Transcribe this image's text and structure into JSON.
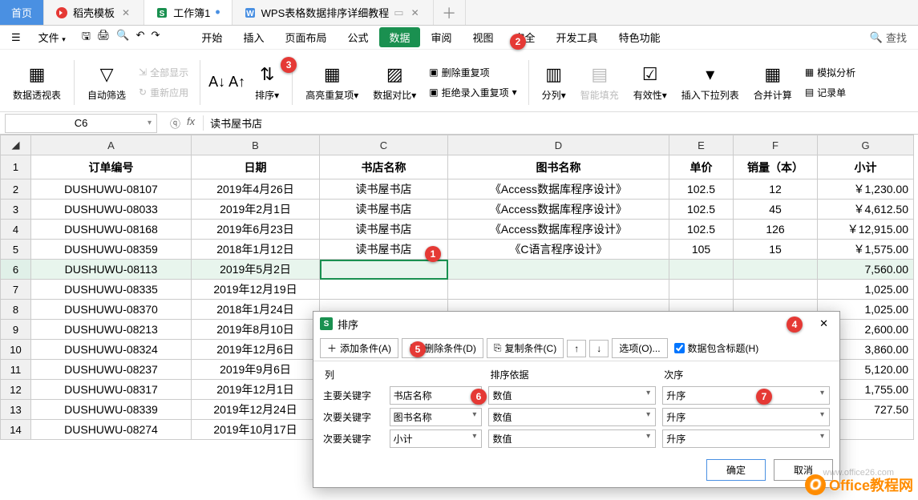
{
  "tabs": {
    "home": "首页",
    "tpl": "稻壳模板",
    "wb": "工作簿1",
    "tutorial": "WPS表格数据排序详细教程"
  },
  "menu": {
    "file": "文件",
    "items": [
      "开始",
      "插入",
      "页面布局",
      "公式",
      "数据",
      "审阅",
      "视图",
      "安全",
      "开发工具",
      "特色功能"
    ],
    "search": "查找"
  },
  "ribbon": {
    "pivot": "数据透视表",
    "autofilter": "自动筛选",
    "showall": "全部显示",
    "reapply": "重新应用",
    "sort": "排序",
    "highlight": "高亮重复项",
    "compare": "数据对比",
    "deldup": "删除重复项",
    "rejectdup": "拒绝录入重复项",
    "split": "分列",
    "smartfill": "智能填充",
    "validity": "有效性",
    "insertdd": "插入下拉列表",
    "merge": "合并计算",
    "whatif": "模拟分析",
    "record": "记录单"
  },
  "fbar": {
    "ref": "C6",
    "val": "读书屋书店"
  },
  "cols": [
    "A",
    "B",
    "C",
    "D",
    "E",
    "F",
    "G"
  ],
  "head": [
    "订单编号",
    "日期",
    "书店名称",
    "图书名称",
    "单价",
    "销量（本）",
    "小计"
  ],
  "rows": [
    [
      "DUSHUWU-08107",
      "2019年4月26日",
      "读书屋书店",
      "《Access数据库程序设计》",
      "102.5",
      "12",
      "￥1,230.00"
    ],
    [
      "DUSHUWU-08033",
      "2019年2月1日",
      "读书屋书店",
      "《Access数据库程序设计》",
      "102.5",
      "45",
      "￥4,612.50"
    ],
    [
      "DUSHUWU-08168",
      "2019年6月23日",
      "读书屋书店",
      "《Access数据库程序设计》",
      "102.5",
      "126",
      "￥12,915.00"
    ],
    [
      "DUSHUWU-08359",
      "2018年1月12日",
      "读书屋书店",
      "《C语言程序设计》",
      "105",
      "15",
      "￥1,575.00"
    ],
    [
      "DUSHUWU-08113",
      "2019年5月2日",
      "",
      "",
      "",
      "",
      "7,560.00"
    ],
    [
      "DUSHUWU-08335",
      "2019年12月19日",
      "",
      "",
      "",
      "",
      "1,025.00"
    ],
    [
      "DUSHUWU-08370",
      "2018年1月24日",
      "",
      "",
      "",
      "",
      "1,025.00"
    ],
    [
      "DUSHUWU-08213",
      "2019年8月10日",
      "",
      "",
      "",
      "",
      "2,600.00"
    ],
    [
      "DUSHUWU-08324",
      "2019年12月6日",
      "",
      "",
      "",
      "",
      "3,860.00"
    ],
    [
      "DUSHUWU-08237",
      "2019年9月6日",
      "",
      "",
      "",
      "",
      "5,120.00"
    ],
    [
      "DUSHUWU-08317",
      "2019年12月1日",
      "",
      "",
      "",
      "",
      "1,755.00"
    ],
    [
      "DUSHUWU-08339",
      "2019年12月24日",
      "",
      "",
      "",
      "",
      "727.50"
    ],
    [
      "DUSHUWU-08274",
      "2019年10月17日",
      "",
      "",
      "",
      "",
      ""
    ]
  ],
  "dialog": {
    "title": "排序",
    "addcond": "添加条件(A)",
    "delcond": "删除条件(D)",
    "copycond": "复制条件(C)",
    "options": "选项(O)...",
    "hasheader": "数据包含标题(H)",
    "col_label": "列",
    "sort_by": "排序依据",
    "order": "次序",
    "rows": [
      {
        "key": "主要关键字",
        "col": "书店名称",
        "by": "数值",
        "ord": "升序"
      },
      {
        "key": "次要关键字",
        "col": "图书名称",
        "by": "数值",
        "ord": "升序"
      },
      {
        "key": "次要关键字",
        "col": "小计",
        "by": "数值",
        "ord": "升序"
      }
    ],
    "ok": "确定",
    "cancel": "取消"
  },
  "balls": {
    "1": "1",
    "2": "2",
    "3": "3",
    "4": "4",
    "5": "5",
    "6": "6",
    "7": "7"
  },
  "watermark": {
    "brand": "Office教程网",
    "url": "www.office26.com"
  }
}
